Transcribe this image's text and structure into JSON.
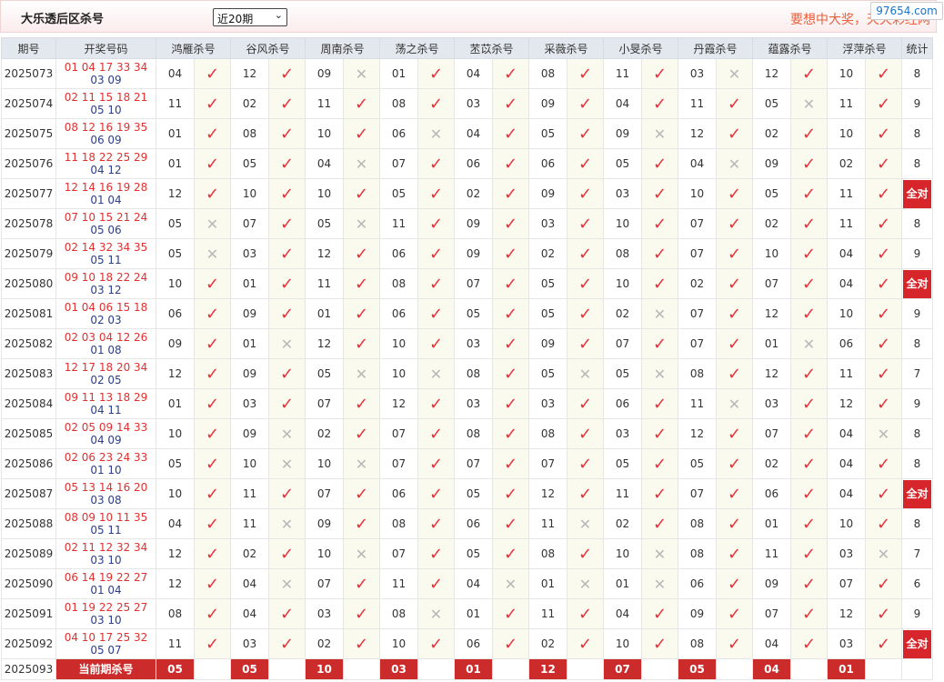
{
  "header": {
    "title": "大乐透后区杀号",
    "range_select": "近20期",
    "slogan": "要想中大奖，天天彩经网",
    "watermark": "97654.com"
  },
  "table": {
    "headers": [
      "期号",
      "开奖号码",
      "鸿雁杀号",
      "谷风杀号",
      "周南杀号",
      "荡之杀号",
      "苤苡杀号",
      "采薇杀号",
      "小旻杀号",
      "丹霞杀号",
      "蕴露杀号",
      "浮萍杀号",
      "统计"
    ],
    "all_correct_label": "全对",
    "rows": [
      {
        "period": "2025073",
        "front": "01 04 17 33 34",
        "back": "03 09",
        "nums": [
          "04",
          "12",
          "09",
          "01",
          "04",
          "08",
          "11",
          "03",
          "12",
          "10"
        ],
        "hits": [
          1,
          1,
          0,
          1,
          1,
          1,
          1,
          0,
          1,
          1
        ],
        "stat": "8"
      },
      {
        "period": "2025074",
        "front": "02 11 15 18 21",
        "back": "05 10",
        "nums": [
          "11",
          "02",
          "11",
          "08",
          "03",
          "09",
          "04",
          "11",
          "05",
          "11"
        ],
        "hits": [
          1,
          1,
          1,
          1,
          1,
          1,
          1,
          1,
          0,
          1
        ],
        "stat": "9"
      },
      {
        "period": "2025075",
        "front": "08 12 16 19 35",
        "back": "06 09",
        "nums": [
          "01",
          "08",
          "10",
          "06",
          "04",
          "05",
          "09",
          "12",
          "02",
          "10"
        ],
        "hits": [
          1,
          1,
          1,
          0,
          1,
          1,
          0,
          1,
          1,
          1
        ],
        "stat": "8"
      },
      {
        "period": "2025076",
        "front": "11 18 22 25 29",
        "back": "04 12",
        "nums": [
          "01",
          "05",
          "04",
          "07",
          "06",
          "06",
          "05",
          "04",
          "09",
          "02"
        ],
        "hits": [
          1,
          1,
          0,
          1,
          1,
          1,
          1,
          0,
          1,
          1
        ],
        "stat": "8"
      },
      {
        "period": "2025077",
        "front": "12 14 16 19 28",
        "back": "01 04",
        "nums": [
          "12",
          "10",
          "10",
          "05",
          "02",
          "09",
          "03",
          "10",
          "05",
          "11"
        ],
        "hits": [
          1,
          1,
          1,
          1,
          1,
          1,
          1,
          1,
          1,
          1
        ],
        "stat": "全对"
      },
      {
        "period": "2025078",
        "front": "07 10 15 21 24",
        "back": "05 06",
        "nums": [
          "05",
          "07",
          "05",
          "11",
          "09",
          "03",
          "10",
          "07",
          "02",
          "11"
        ],
        "hits": [
          0,
          1,
          0,
          1,
          1,
          1,
          1,
          1,
          1,
          1
        ],
        "stat": "8"
      },
      {
        "period": "2025079",
        "front": "02 14 32 34 35",
        "back": "05 11",
        "nums": [
          "05",
          "03",
          "12",
          "06",
          "09",
          "02",
          "08",
          "07",
          "10",
          "04"
        ],
        "hits": [
          0,
          1,
          1,
          1,
          1,
          1,
          1,
          1,
          1,
          1
        ],
        "stat": "9"
      },
      {
        "period": "2025080",
        "front": "09 10 18 22 24",
        "back": "03 12",
        "nums": [
          "10",
          "01",
          "11",
          "08",
          "07",
          "05",
          "10",
          "02",
          "07",
          "04"
        ],
        "hits": [
          1,
          1,
          1,
          1,
          1,
          1,
          1,
          1,
          1,
          1
        ],
        "stat": "全对"
      },
      {
        "period": "2025081",
        "front": "01 04 06 15 18",
        "back": "02 03",
        "nums": [
          "06",
          "09",
          "01",
          "06",
          "05",
          "05",
          "02",
          "07",
          "12",
          "10"
        ],
        "hits": [
          1,
          1,
          1,
          1,
          1,
          1,
          0,
          1,
          1,
          1
        ],
        "stat": "9"
      },
      {
        "period": "2025082",
        "front": "02 03 04 12 26",
        "back": "01 08",
        "nums": [
          "09",
          "01",
          "12",
          "10",
          "03",
          "09",
          "07",
          "07",
          "01",
          "06"
        ],
        "hits": [
          1,
          0,
          1,
          1,
          1,
          1,
          1,
          1,
          0,
          1
        ],
        "stat": "8"
      },
      {
        "period": "2025083",
        "front": "12 17 18 20 34",
        "back": "02 05",
        "nums": [
          "12",
          "09",
          "05",
          "10",
          "08",
          "05",
          "05",
          "08",
          "12",
          "11"
        ],
        "hits": [
          1,
          1,
          0,
          0,
          1,
          0,
          0,
          1,
          1,
          1
        ],
        "stat": "7"
      },
      {
        "period": "2025084",
        "front": "09 11 13 18 29",
        "back": "04 11",
        "nums": [
          "01",
          "03",
          "07",
          "12",
          "03",
          "03",
          "06",
          "11",
          "03",
          "12"
        ],
        "hits": [
          1,
          1,
          1,
          1,
          1,
          1,
          1,
          0,
          1,
          1
        ],
        "stat": "9"
      },
      {
        "period": "2025085",
        "front": "02 05 09 14 33",
        "back": "04 09",
        "nums": [
          "10",
          "09",
          "02",
          "07",
          "08",
          "08",
          "03",
          "12",
          "07",
          "04"
        ],
        "hits": [
          1,
          0,
          1,
          1,
          1,
          1,
          1,
          1,
          1,
          0
        ],
        "stat": "8"
      },
      {
        "period": "2025086",
        "front": "02 06 23 24 33",
        "back": "01 10",
        "nums": [
          "05",
          "10",
          "10",
          "07",
          "07",
          "07",
          "05",
          "05",
          "02",
          "04"
        ],
        "hits": [
          1,
          0,
          0,
          1,
          1,
          1,
          1,
          1,
          1,
          1
        ],
        "stat": "8"
      },
      {
        "period": "2025087",
        "front": "05 13 14 16 20",
        "back": "03 08",
        "nums": [
          "10",
          "11",
          "07",
          "06",
          "05",
          "12",
          "11",
          "07",
          "06",
          "04"
        ],
        "hits": [
          1,
          1,
          1,
          1,
          1,
          1,
          1,
          1,
          1,
          1
        ],
        "stat": "全对"
      },
      {
        "period": "2025088",
        "front": "08 09 10 11 35",
        "back": "05 11",
        "nums": [
          "04",
          "11",
          "09",
          "08",
          "06",
          "11",
          "02",
          "08",
          "01",
          "10"
        ],
        "hits": [
          1,
          0,
          1,
          1,
          1,
          0,
          1,
          1,
          1,
          1
        ],
        "stat": "8"
      },
      {
        "period": "2025089",
        "front": "02 11 12 32 34",
        "back": "03 10",
        "nums": [
          "12",
          "02",
          "10",
          "07",
          "05",
          "08",
          "10",
          "08",
          "11",
          "03"
        ],
        "hits": [
          1,
          1,
          0,
          1,
          1,
          1,
          0,
          1,
          1,
          0
        ],
        "stat": "7"
      },
      {
        "period": "2025090",
        "front": "06 14 19 22 27",
        "back": "01 04",
        "nums": [
          "12",
          "04",
          "07",
          "11",
          "04",
          "01",
          "01",
          "06",
          "09",
          "07"
        ],
        "hits": [
          1,
          0,
          1,
          1,
          0,
          0,
          0,
          1,
          1,
          1
        ],
        "stat": "6"
      },
      {
        "period": "2025091",
        "front": "01 19 22 25 27",
        "back": "03 10",
        "nums": [
          "08",
          "04",
          "03",
          "08",
          "01",
          "11",
          "04",
          "09",
          "07",
          "12"
        ],
        "hits": [
          1,
          1,
          1,
          0,
          1,
          1,
          1,
          1,
          1,
          1
        ],
        "stat": "9"
      },
      {
        "period": "2025092",
        "front": "04 10 17 25 32",
        "back": "05 07",
        "nums": [
          "11",
          "03",
          "02",
          "10",
          "06",
          "02",
          "10",
          "08",
          "04",
          "03"
        ],
        "hits": [
          1,
          1,
          1,
          1,
          1,
          1,
          1,
          1,
          1,
          1
        ],
        "stat": "全对"
      }
    ],
    "current": {
      "period": "2025093",
      "label": "当前期杀号",
      "nums": [
        "05",
        "05",
        "10",
        "03",
        "01",
        "12",
        "07",
        "05",
        "04",
        "01"
      ]
    }
  },
  "icons": {
    "hit": "check-icon",
    "miss": "cross-icon"
  },
  "colors": {
    "hit": "#e8303a",
    "miss": "#b8b8b8",
    "all_correct_bg": "#d6262b",
    "front": "#e03030",
    "back": "#2c3e8c"
  }
}
